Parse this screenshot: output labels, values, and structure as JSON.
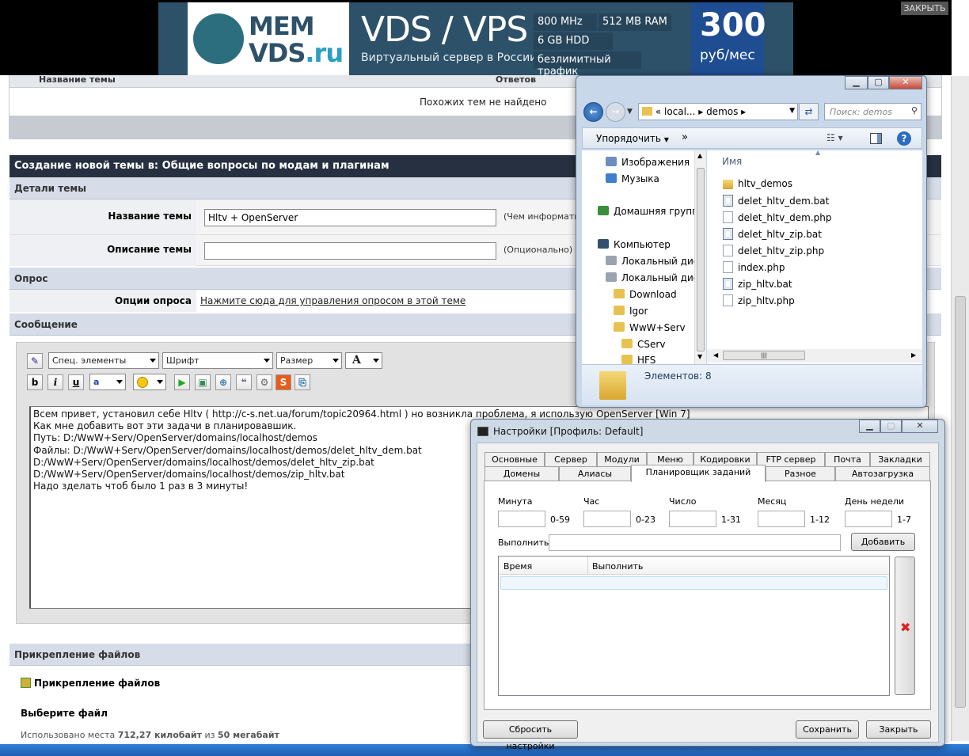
{
  "ad": {
    "close": "ЗАКРЫТЬ",
    "brand1": "MEM",
    "brand2": "VDS",
    "brand3": ".ru",
    "headline": "VDS / VPS",
    "subline": "Виртуальный сервер в России",
    "spec_cpu": "800 MHz",
    "spec_ram": "512 MB RAM",
    "spec_hdd": "6 GB HDD",
    "spec_traffic": "безлимитный трафик",
    "price": "300",
    "price_unit": "руб/мес"
  },
  "similar": {
    "col_title": "Название темы",
    "col_replies": "Ответов",
    "empty": "Похожих тем не найдено"
  },
  "form": {
    "header": "Создание новой темы в: Общие вопросы по модам и плагинам",
    "details_section": "Детали темы",
    "title_label": "Название темы",
    "title_value": "Hltv + OpenServer",
    "title_hint": "(Чем информатив",
    "desc_label": "Описание темы",
    "desc_value": "",
    "desc_hint": "(Опционально)",
    "poll_section": "Опрос",
    "poll_label": "Опции опроса",
    "poll_link": "Нажмите сюда для управления опросом в этой теме",
    "message_section": "Сообщение",
    "toolbar": {
      "special": "Спец. элементы",
      "font": "Шрифт",
      "size": "Размер",
      "color_letter": "A",
      "bold": "b",
      "italic": "i",
      "underline": "u"
    },
    "message_lines": [
      "Всем привет, установил себе Hltv ( http://c-s.net.ua/forum/topic20964.html ) но возникла проблема, я использую OpenServer [Win 7]",
      "Как мне добавить вот эти задачи в планировавшик.",
      "Путь: D:/WwW+Serv/OpenServer/domains/localhost/demos",
      "Файлы: D:/WwW+Serv/OpenServer/domains/localhost/demos/delet_hltv_dem.bat",
      "D:/WwW+Serv/OpenServer/domains/localhost/demos/delet_hltv_zip.bat",
      "D:/WwW+Serv/OpenServer/domains/localhost/demos/zip_hltv.bat",
      "Надо зделать чтоб было 1 раз в 3 минуты!"
    ],
    "attach_section": "Прикрепление файлов",
    "attach_title": "Прикрепление файлов",
    "choose_file": "Выберите файл",
    "usage_prefix": "Использовано места",
    "usage_used": "712,27 килобайт",
    "usage_of": "из",
    "usage_total": "50 мегабайт"
  },
  "explorer": {
    "path": [
      "local...",
      "demos"
    ],
    "path_prefix": "«",
    "search_placeholder": "Поиск: demos",
    "organize": "Упорядочить",
    "more": "»",
    "col_name": "Имя",
    "tree": [
      {
        "label": "Изображения",
        "icon": "pictures-icon"
      },
      {
        "label": "Музыка",
        "icon": "music-icon"
      },
      {
        "label": "Домашняя группа",
        "icon": "homegroup-icon"
      },
      {
        "label": "Компьютер",
        "icon": "computer-icon"
      },
      {
        "label": "Локальный диск",
        "icon": "drive-icon"
      },
      {
        "label": "Локальный диск",
        "icon": "drive-icon"
      },
      {
        "label": "Download",
        "icon": "folder-icon"
      },
      {
        "label": "Igor",
        "icon": "folder-icon"
      },
      {
        "label": "WwW+Serv",
        "icon": "folder-icon"
      },
      {
        "label": "CServ",
        "icon": "folder-icon"
      },
      {
        "label": "HFS",
        "icon": "folder-icon"
      }
    ],
    "files": [
      {
        "name": "hltv_demos",
        "icon": "folder-icon"
      },
      {
        "name": "delet_hltv_dem.bat",
        "icon": "bat-file-icon"
      },
      {
        "name": "delet_hltv_dem.php",
        "icon": "file-icon"
      },
      {
        "name": "delet_hltv_zip.bat",
        "icon": "bat-file-icon"
      },
      {
        "name": "delet_hltv_zip.php",
        "icon": "file-icon"
      },
      {
        "name": "index.php",
        "icon": "file-icon"
      },
      {
        "name": "zip_hltv.bat",
        "icon": "bat-file-icon"
      },
      {
        "name": "zip_hltv.php",
        "icon": "file-icon"
      }
    ],
    "status": "Элементов: 8"
  },
  "settings": {
    "title": "Настройки [Профиль: Default]",
    "tabs_row1": [
      "Основные",
      "Сервер",
      "Модули",
      "Меню",
      "Кодировки",
      "FTP сервер",
      "Почта",
      "Закладки"
    ],
    "tabs_row2": [
      "Домены",
      "Алиасы",
      "Планировщик заданий",
      "Разное",
      "Автозагрузка"
    ],
    "active_tab": "Планировщик заданий",
    "minute": "Минута",
    "minute_range": "0-59",
    "hour": "Час",
    "hour_range": "0-23",
    "day": "Число",
    "day_range": "1-31",
    "month": "Месяц",
    "month_range": "1-12",
    "weekday": "День недели",
    "weekday_range": "1-7",
    "run": "Выполнить",
    "add": "Добавить",
    "col_time": "Время",
    "col_run": "Выполнить",
    "reset": "Сбросить настройки",
    "save": "Сохранить",
    "close": "Закрыть"
  }
}
